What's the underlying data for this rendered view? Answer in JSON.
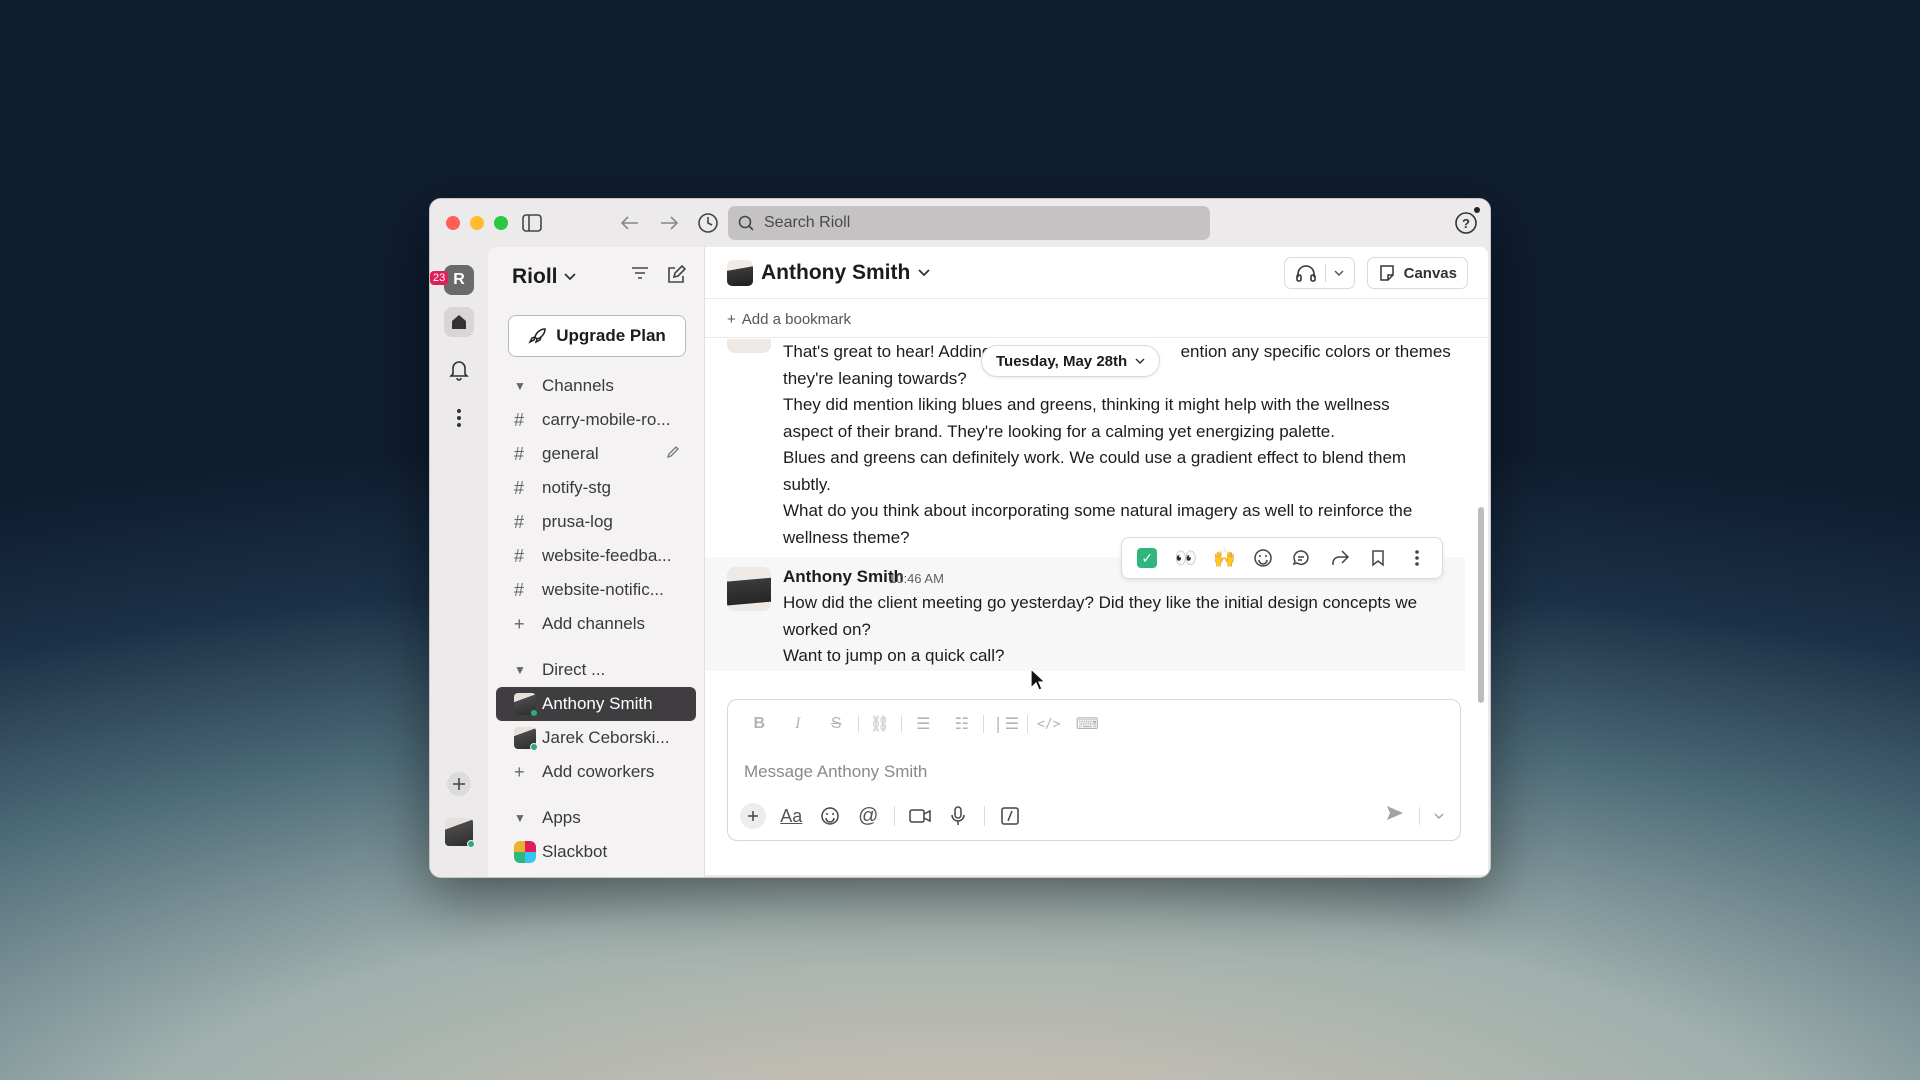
{
  "search": {
    "placeholder": "Search Rioll"
  },
  "rail": {
    "workspace_initial": "R",
    "notification_count": "23"
  },
  "sidebar": {
    "workspace_name": "Rioll",
    "upgrade_label": "Upgrade Plan",
    "channels_header": "Channels",
    "channels": [
      "carry-mobile-ro...",
      "general",
      "notify-stg",
      "prusa-log",
      "website-feedba...",
      "website-notific..."
    ],
    "add_channels": "Add channels",
    "direct_header": "Direct ...",
    "directs": [
      "Anthony Smith",
      "Jarek Ceborski..."
    ],
    "add_coworkers": "Add coworkers",
    "apps_header": "Apps",
    "apps": [
      "Slackbot"
    ]
  },
  "header": {
    "title": "Anthony Smith",
    "canvas_label": "Canvas",
    "bookmark": "Add a bookmark"
  },
  "messages": {
    "date_pill": "Tuesday, May 28th",
    "partial_left": "That's great to hear! Adding c",
    "partial_right": "ention any specific colors or themes",
    "lines": [
      "they're leaning towards?",
      "They did mention liking blues and greens, thinking it might help with the wellness",
      "aspect of their brand. They're looking for a calming yet energizing palette.",
      "Blues and greens can definitely work. We could use a gradient effect to blend them",
      "subtly.",
      "What do you think about incorporating some natural imagery as well to reinforce the",
      "wellness theme?"
    ],
    "last": {
      "sender": "Anthony Smith",
      "time": "10:46 AM",
      "lines": [
        "How did the client meeting go yesterday? Did they like the initial design concepts we",
        "worked on?",
        "Want to jump on a quick call?"
      ]
    }
  },
  "composer": {
    "placeholder": "Message Anthony Smith",
    "text_style": "Aa"
  }
}
